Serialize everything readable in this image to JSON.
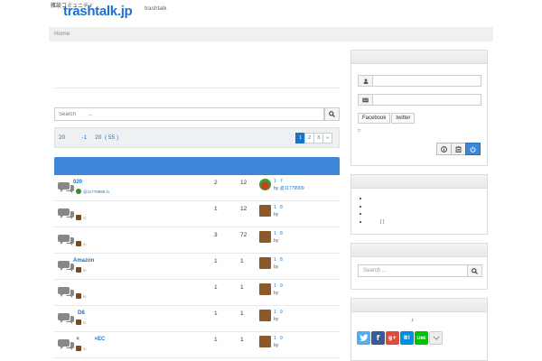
{
  "header": {
    "logo_subtitle": "雑談コミュニティ",
    "logo_title": "trashtalk.jp",
    "nav_item": "trashtalk"
  },
  "breadcrumb": {
    "home": "Home"
  },
  "search_main": {
    "placeholder": "Search        ..."
  },
  "pager": {
    "info": "20          -1     20  ( 55 )",
    "pages": [
      "1",
      "2",
      "3",
      "»"
    ],
    "active": "1"
  },
  "topics": [
    {
      "title": "020",
      "starter": "@11779999 in",
      "posts": "2",
      "views": "12",
      "last": "1   7",
      "last_by": "by ",
      "last_by_link": "@11779999",
      "avatar": "melon"
    },
    {
      "title": "",
      "starter": "in",
      "posts": "1",
      "views": "12",
      "last": "1   8",
      "last_by": "by",
      "last_by_link": "",
      "avatar": "brown"
    },
    {
      "title": "",
      "starter": "in",
      "posts": "3",
      "views": "72",
      "last": "1   8",
      "last_by": "by",
      "last_by_link": "",
      "avatar": "brown"
    },
    {
      "title": "Amazon",
      "starter": "in",
      "posts": "1",
      "views": "1",
      "last": "1   8",
      "last_by": "by",
      "last_by_link": "",
      "avatar": "brown"
    },
    {
      "title": "",
      "starter": "in",
      "posts": "1",
      "views": "1",
      "last": "1   9",
      "last_by": "by",
      "last_by_link": "",
      "avatar": "brown"
    },
    {
      "title": "   D8",
      "starter": "in",
      "posts": "1",
      "views": "1",
      "last": "1   9",
      "last_by": "by",
      "last_by_link": "",
      "avatar": "brown"
    },
    {
      "title": "  ×          ×EC",
      "starter": "in",
      "posts": "1",
      "views": "1",
      "last": "1   9",
      "last_by": "by",
      "last_by_link": "",
      "avatar": "brown"
    }
  ],
  "login": {
    "sns": [
      "Facebook",
      "twitter"
    ],
    "remember": "□"
  },
  "links_widget": {
    "items": [
      "",
      "",
      "",
      "[   ]"
    ]
  },
  "search_side": {
    "placeholder": "Search        ..."
  },
  "share": {
    "note": "♪",
    "buttons": [
      "twitter-share-icon",
      "facebook-share-icon",
      "googleplus-share-icon",
      "hatena-share-icon",
      "line-share-icon",
      "more-share-icon"
    ]
  },
  "colors": {
    "accent": "#3d86d8",
    "link": "#1a73c8"
  }
}
